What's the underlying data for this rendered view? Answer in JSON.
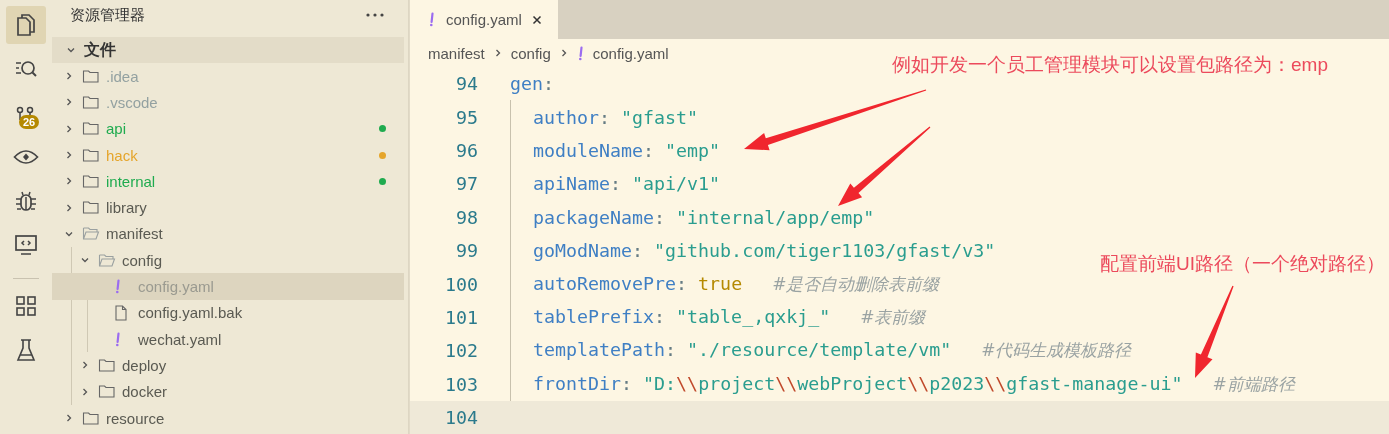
{
  "activity_bar": {
    "top": [
      {
        "kind": "files",
        "selected": true
      },
      {
        "kind": "search",
        "selected": false
      },
      {
        "kind": "source-control",
        "selected": false,
        "badge": "26"
      },
      {
        "kind": "remote",
        "selected": false
      },
      {
        "kind": "debug",
        "selected": false
      },
      {
        "kind": "monitor",
        "selected": false
      }
    ],
    "bottom": [
      {
        "kind": "extensions",
        "selected": false
      },
      {
        "kind": "testing",
        "selected": false
      }
    ]
  },
  "explorer": {
    "title": "资源管理器",
    "section": {
      "title": "文件",
      "expanded": true
    },
    "items": [
      {
        "kind": "folder",
        "name": ".idea",
        "expanded": false,
        "selected": false,
        "color": "#93a1a1",
        "modified": false
      },
      {
        "kind": "folder",
        "name": ".vscode",
        "expanded": false,
        "selected": false,
        "color": "#93a1a1",
        "modified": false
      },
      {
        "kind": "folder",
        "name": "api",
        "expanded": false,
        "selected": false,
        "color": "#1fab4f",
        "modified": true
      },
      {
        "kind": "folder",
        "name": "hack",
        "expanded": false,
        "selected": false,
        "color": "#e5a52b",
        "modified": true
      },
      {
        "kind": "folder",
        "name": "internal",
        "expanded": false,
        "selected": false,
        "color": "#1fab4f",
        "modified": true
      },
      {
        "kind": "folder",
        "name": "library",
        "expanded": false,
        "selected": false,
        "color": "#5a5a52",
        "modified": false
      },
      {
        "kind": "folder",
        "name": "manifest",
        "expanded": true,
        "selected": false,
        "color": "#5a5a52",
        "modified": false,
        "children": [
          {
            "kind": "folder",
            "name": "config",
            "expanded": true,
            "selected": false,
            "color": "#5a5a52",
            "modified": false,
            "children": [
              {
                "kind": "yaml",
                "name": "config.yaml",
                "selected": true,
                "color": "#9a9a90",
                "modified": false
              },
              {
                "kind": "file",
                "name": "config.yaml.bak",
                "selected": false,
                "color": "#5a5a52",
                "modified": false
              },
              {
                "kind": "yaml",
                "name": "wechat.yaml",
                "selected": false,
                "color": "#5a5a52",
                "modified": false
              }
            ]
          },
          {
            "kind": "folder",
            "name": "deploy",
            "expanded": false,
            "selected": false,
            "color": "#5a5a52",
            "modified": false
          },
          {
            "kind": "folder",
            "name": "docker",
            "expanded": false,
            "selected": false,
            "color": "#5a5a52",
            "modified": false
          }
        ]
      },
      {
        "kind": "folder",
        "name": "resource",
        "expanded": false,
        "selected": false,
        "color": "#5a5a52",
        "modified": false
      }
    ]
  },
  "tabs": [
    {
      "label": "config.yaml",
      "selected": true
    }
  ],
  "breadcrumb": [
    {
      "kind": "folder",
      "label": "manifest"
    },
    {
      "kind": "folder",
      "label": "config"
    },
    {
      "kind": "yaml",
      "label": "config.yaml"
    }
  ],
  "code": [
    {
      "number": "94",
      "current": false,
      "tokens": [
        {
          "kind": "key",
          "text": "gen"
        },
        {
          "kind": "punct",
          "text": ":"
        }
      ],
      "children": [
        {
          "number": "95",
          "current": false,
          "tokens": [
            {
              "kind": "key",
              "text": "author"
            },
            {
              "kind": "punct",
              "text": ": "
            },
            {
              "kind": "string",
              "text": "\"gfast\""
            }
          ]
        },
        {
          "number": "96",
          "current": false,
          "tokens": [
            {
              "kind": "key",
              "text": "moduleName"
            },
            {
              "kind": "punct",
              "text": ": "
            },
            {
              "kind": "string",
              "text": "\"emp\""
            }
          ]
        },
        {
          "number": "97",
          "current": false,
          "tokens": [
            {
              "kind": "key",
              "text": "apiName"
            },
            {
              "kind": "punct",
              "text": ": "
            },
            {
              "kind": "string",
              "text": "\"api/v1\""
            }
          ]
        },
        {
          "number": "98",
          "current": false,
          "tokens": [
            {
              "kind": "key",
              "text": "packageName"
            },
            {
              "kind": "punct",
              "text": ": "
            },
            {
              "kind": "string",
              "text": "\"internal/app/emp\""
            }
          ]
        },
        {
          "number": "99",
          "current": false,
          "tokens": [
            {
              "kind": "key",
              "text": "goModName"
            },
            {
              "kind": "punct",
              "text": ": "
            },
            {
              "kind": "string",
              "text": "\"github.com/tiger1103/gfast/v3\""
            }
          ]
        },
        {
          "number": "100",
          "current": false,
          "tokens": [
            {
              "kind": "key",
              "text": "autoRemovePre"
            },
            {
              "kind": "punct",
              "text": ": "
            },
            {
              "kind": "bool",
              "text": "true"
            },
            {
              "kind": "comment",
              "text": "#是否自动删除表前缀"
            }
          ]
        },
        {
          "number": "101",
          "current": false,
          "tokens": [
            {
              "kind": "key",
              "text": "tablePrefix"
            },
            {
              "kind": "punct",
              "text": ": "
            },
            {
              "kind": "string",
              "text": "\"table_,qxkj_\""
            },
            {
              "kind": "comment",
              "text": "#表前缀"
            }
          ]
        },
        {
          "number": "102",
          "current": false,
          "tokens": [
            {
              "kind": "key",
              "text": "templatePath"
            },
            {
              "kind": "punct",
              "text": ": "
            },
            {
              "kind": "string",
              "text": "\"./resource/template/vm\""
            },
            {
              "kind": "comment",
              "text": "#代码生成模板路径"
            }
          ]
        },
        {
          "number": "103",
          "current": false,
          "tokens": [
            {
              "kind": "key",
              "text": "frontDir"
            },
            {
              "kind": "punct",
              "text": ": "
            },
            {
              "kind": "string",
              "text": "\"D:"
            },
            {
              "kind": "escape",
              "text": "\\\\"
            },
            {
              "kind": "string",
              "text": "project"
            },
            {
              "kind": "escape",
              "text": "\\\\"
            },
            {
              "kind": "string",
              "text": "webProject"
            },
            {
              "kind": "escape",
              "text": "\\\\"
            },
            {
              "kind": "string",
              "text": "p2023"
            },
            {
              "kind": "escape",
              "text": "\\\\"
            },
            {
              "kind": "string",
              "text": "gfast-manage-ui\""
            },
            {
              "kind": "comment",
              "text": "#前端路径"
            }
          ]
        }
      ]
    },
    {
      "number": "104",
      "current": true
    }
  ],
  "annotations": [
    {
      "text": "例如开发一个员工管理模块可以设置包路径为：emp"
    },
    {
      "text": "配置前端UI路径（一个绝对路径）"
    }
  ]
}
